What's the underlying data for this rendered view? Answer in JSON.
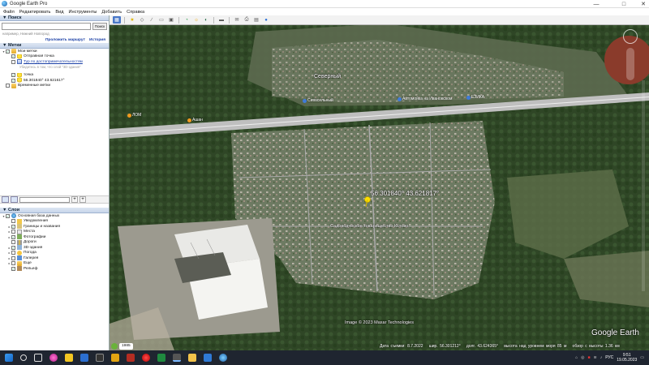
{
  "window": {
    "title": "Google Earth Pro"
  },
  "menu": [
    "Файл",
    "Редактировать",
    "Вид",
    "Инструменты",
    "Добавить",
    "Справка"
  ],
  "search": {
    "header": "Поиск",
    "button": "Поиск",
    "hint": "например, Нижний Новгород",
    "route_link": "Проложить маршрут",
    "history_link": "История"
  },
  "places": {
    "header": "Метки",
    "items": [
      {
        "label": "Мои метки"
      },
      {
        "label": "Отправная точка"
      },
      {
        "label": "Тур по достопримечательностям",
        "sub": "Убедитесь в том, что слой \"3D-здания\""
      },
      {
        "label": "точка"
      },
      {
        "label": "56.301840°  43.621617°"
      },
      {
        "label": "Временные метки"
      }
    ]
  },
  "layers": {
    "header": "Слои",
    "items": [
      "Основная база данных",
      "Уведомления",
      "Границы и названия",
      "Места",
      "Фотографии",
      "Дороги",
      "3D-здания",
      "Погода",
      "Галерея",
      "Еще",
      "Рельеф"
    ]
  },
  "map": {
    "label_north": "Северный",
    "placemark_label": "56.301840° 43.621817°",
    "settlement_label": "Садоводческое товарищество Кстово",
    "poi_1": "Сивасильный",
    "poi_2": "Кафе МакС",
    "poi_3": "Автомойка на Ивановском",
    "poi_4": "ЕЗИКА",
    "poi_5": "Ашан",
    "poi_6": "ЛОМ",
    "copyright": "Image © 2023 Maxar Technologies",
    "logo": "Google Earth",
    "history_year": "1985"
  },
  "status": {
    "date": "Дата съемки: 8.7.2022",
    "lat": "шир.   56.301212°",
    "lon": "долг.   43.624365°",
    "elev": "высота над уровнем моря   85 м",
    "eye": "обзор с высоты   1.36 км"
  },
  "taskbar": {
    "lang": "РУС",
    "time": "9:51",
    "date": "19.05.2023"
  },
  "colors": {
    "forest": "#344d2a",
    "settlement": "#6f7b66",
    "road": "#c9c9c9",
    "placemark": "#ffe000"
  }
}
